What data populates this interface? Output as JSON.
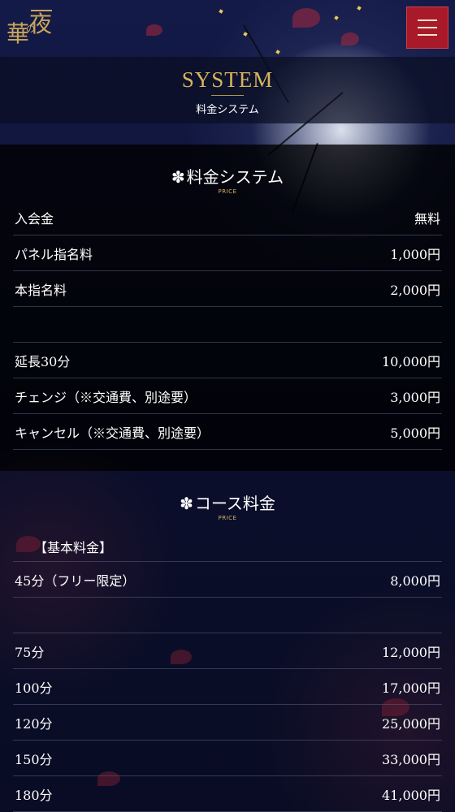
{
  "header": {
    "logo_text": "一夜の華",
    "logo_chars": [
      "華",
      "の",
      "夜"
    ],
    "menu_icon": "hamburger-icon",
    "accent": "#a81a2a"
  },
  "page": {
    "title_en": "SYSTEM",
    "title_jp": "料金システム"
  },
  "price_section": {
    "flower": "✽",
    "title": "料金システム",
    "sub": "PRICE",
    "rows": [
      {
        "label": "入会金",
        "value": "無料"
      },
      {
        "label": "パネル指名料",
        "value": "1,000円"
      },
      {
        "label": "本指名料",
        "value": "2,000円"
      },
      {
        "label": "",
        "value": ""
      },
      {
        "label": "延長30分",
        "value": "10,000円"
      },
      {
        "label": "チェンジ（※交通費、別途要）",
        "value": "3,000円"
      },
      {
        "label": "キャンセル（※交通費、別途要）",
        "value": "5,000円"
      }
    ]
  },
  "course_section": {
    "flower": "✽",
    "title": "コース料金",
    "sub": "PRICE",
    "subhead": "【基本料金】",
    "rows": [
      {
        "label": "45分（フリー限定）",
        "value": "8,000円"
      },
      {
        "label": "",
        "value": ""
      },
      {
        "label": "75分",
        "value": "12,000円"
      },
      {
        "label": "100分",
        "value": "17,000円"
      },
      {
        "label": "120分",
        "value": "25,000円"
      },
      {
        "label": "150分",
        "value": "33,000円"
      },
      {
        "label": "180分",
        "value": "41,000円"
      }
    ]
  }
}
